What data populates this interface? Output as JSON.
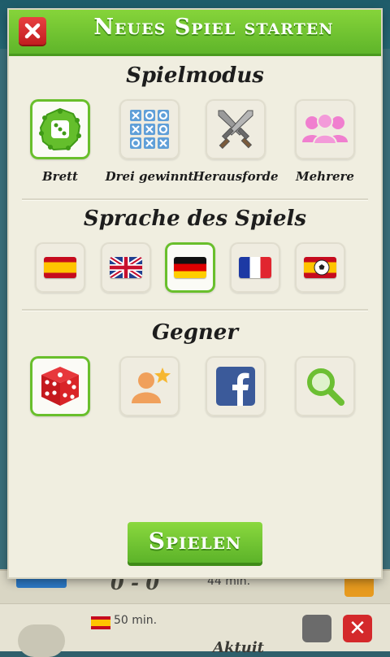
{
  "background": {
    "score": "0 - 0",
    "time_1": "44 min.",
    "time_2": "50 min.",
    "partial_label": "Aktuit"
  },
  "header": {
    "title": "Neues Spiel starten",
    "close_icon": "close-icon"
  },
  "game_mode": {
    "title": "Spielmodus",
    "options": [
      {
        "label": "Brett",
        "icon": "board-dice-icon",
        "selected": true
      },
      {
        "label": "Drei gewinnt",
        "icon": "tic-tac-toe-icon",
        "selected": false
      },
      {
        "label": "Herausforde",
        "icon": "crossed-swords-icon",
        "selected": false
      },
      {
        "label": "Mehrere",
        "icon": "group-icon",
        "selected": false
      }
    ]
  },
  "language": {
    "title": "Sprache des Spiels",
    "options": [
      {
        "icon": "spain-flag-icon",
        "selected": false
      },
      {
        "icon": "uk-flag-icon",
        "selected": false
      },
      {
        "icon": "germany-flag-icon",
        "selected": true
      },
      {
        "icon": "france-flag-icon",
        "selected": false
      },
      {
        "icon": "spain-football-flag-icon",
        "selected": false
      }
    ]
  },
  "opponent": {
    "title": "Gegner",
    "options": [
      {
        "icon": "dice-icon",
        "selected": true
      },
      {
        "icon": "add-friend-icon",
        "selected": false
      },
      {
        "icon": "facebook-icon",
        "selected": false
      },
      {
        "icon": "search-icon",
        "selected": false
      }
    ]
  },
  "play_button": {
    "label": "Spielen"
  },
  "colors": {
    "accent_green": "#6cc230",
    "close_red": "#d42a2a",
    "panel_bg": "#f0eee0"
  }
}
